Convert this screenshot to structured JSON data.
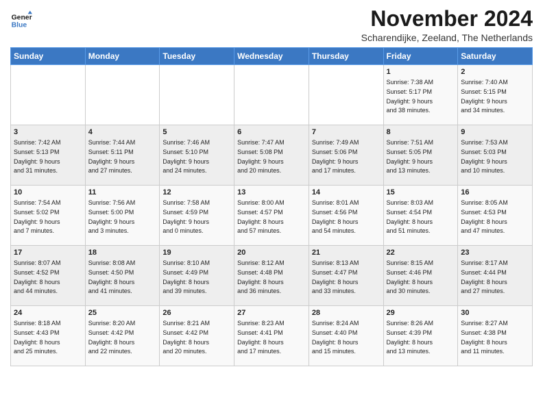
{
  "logo": {
    "line1": "General",
    "line2": "Blue"
  },
  "title": "November 2024",
  "location": "Scharendijke, Zeeland, The Netherlands",
  "weekdays": [
    "Sunday",
    "Monday",
    "Tuesday",
    "Wednesday",
    "Thursday",
    "Friday",
    "Saturday"
  ],
  "weeks": [
    [
      {
        "day": "",
        "info": ""
      },
      {
        "day": "",
        "info": ""
      },
      {
        "day": "",
        "info": ""
      },
      {
        "day": "",
        "info": ""
      },
      {
        "day": "",
        "info": ""
      },
      {
        "day": "1",
        "info": "Sunrise: 7:38 AM\nSunset: 5:17 PM\nDaylight: 9 hours\nand 38 minutes."
      },
      {
        "day": "2",
        "info": "Sunrise: 7:40 AM\nSunset: 5:15 PM\nDaylight: 9 hours\nand 34 minutes."
      }
    ],
    [
      {
        "day": "3",
        "info": "Sunrise: 7:42 AM\nSunset: 5:13 PM\nDaylight: 9 hours\nand 31 minutes."
      },
      {
        "day": "4",
        "info": "Sunrise: 7:44 AM\nSunset: 5:11 PM\nDaylight: 9 hours\nand 27 minutes."
      },
      {
        "day": "5",
        "info": "Sunrise: 7:46 AM\nSunset: 5:10 PM\nDaylight: 9 hours\nand 24 minutes."
      },
      {
        "day": "6",
        "info": "Sunrise: 7:47 AM\nSunset: 5:08 PM\nDaylight: 9 hours\nand 20 minutes."
      },
      {
        "day": "7",
        "info": "Sunrise: 7:49 AM\nSunset: 5:06 PM\nDaylight: 9 hours\nand 17 minutes."
      },
      {
        "day": "8",
        "info": "Sunrise: 7:51 AM\nSunset: 5:05 PM\nDaylight: 9 hours\nand 13 minutes."
      },
      {
        "day": "9",
        "info": "Sunrise: 7:53 AM\nSunset: 5:03 PM\nDaylight: 9 hours\nand 10 minutes."
      }
    ],
    [
      {
        "day": "10",
        "info": "Sunrise: 7:54 AM\nSunset: 5:02 PM\nDaylight: 9 hours\nand 7 minutes."
      },
      {
        "day": "11",
        "info": "Sunrise: 7:56 AM\nSunset: 5:00 PM\nDaylight: 9 hours\nand 3 minutes."
      },
      {
        "day": "12",
        "info": "Sunrise: 7:58 AM\nSunset: 4:59 PM\nDaylight: 9 hours\nand 0 minutes."
      },
      {
        "day": "13",
        "info": "Sunrise: 8:00 AM\nSunset: 4:57 PM\nDaylight: 8 hours\nand 57 minutes."
      },
      {
        "day": "14",
        "info": "Sunrise: 8:01 AM\nSunset: 4:56 PM\nDaylight: 8 hours\nand 54 minutes."
      },
      {
        "day": "15",
        "info": "Sunrise: 8:03 AM\nSunset: 4:54 PM\nDaylight: 8 hours\nand 51 minutes."
      },
      {
        "day": "16",
        "info": "Sunrise: 8:05 AM\nSunset: 4:53 PM\nDaylight: 8 hours\nand 47 minutes."
      }
    ],
    [
      {
        "day": "17",
        "info": "Sunrise: 8:07 AM\nSunset: 4:52 PM\nDaylight: 8 hours\nand 44 minutes."
      },
      {
        "day": "18",
        "info": "Sunrise: 8:08 AM\nSunset: 4:50 PM\nDaylight: 8 hours\nand 41 minutes."
      },
      {
        "day": "19",
        "info": "Sunrise: 8:10 AM\nSunset: 4:49 PM\nDaylight: 8 hours\nand 39 minutes."
      },
      {
        "day": "20",
        "info": "Sunrise: 8:12 AM\nSunset: 4:48 PM\nDaylight: 8 hours\nand 36 minutes."
      },
      {
        "day": "21",
        "info": "Sunrise: 8:13 AM\nSunset: 4:47 PM\nDaylight: 8 hours\nand 33 minutes."
      },
      {
        "day": "22",
        "info": "Sunrise: 8:15 AM\nSunset: 4:46 PM\nDaylight: 8 hours\nand 30 minutes."
      },
      {
        "day": "23",
        "info": "Sunrise: 8:17 AM\nSunset: 4:44 PM\nDaylight: 8 hours\nand 27 minutes."
      }
    ],
    [
      {
        "day": "24",
        "info": "Sunrise: 8:18 AM\nSunset: 4:43 PM\nDaylight: 8 hours\nand 25 minutes."
      },
      {
        "day": "25",
        "info": "Sunrise: 8:20 AM\nSunset: 4:42 PM\nDaylight: 8 hours\nand 22 minutes."
      },
      {
        "day": "26",
        "info": "Sunrise: 8:21 AM\nSunset: 4:42 PM\nDaylight: 8 hours\nand 20 minutes."
      },
      {
        "day": "27",
        "info": "Sunrise: 8:23 AM\nSunset: 4:41 PM\nDaylight: 8 hours\nand 17 minutes."
      },
      {
        "day": "28",
        "info": "Sunrise: 8:24 AM\nSunset: 4:40 PM\nDaylight: 8 hours\nand 15 minutes."
      },
      {
        "day": "29",
        "info": "Sunrise: 8:26 AM\nSunset: 4:39 PM\nDaylight: 8 hours\nand 13 minutes."
      },
      {
        "day": "30",
        "info": "Sunrise: 8:27 AM\nSunset: 4:38 PM\nDaylight: 8 hours\nand 11 minutes."
      }
    ]
  ]
}
